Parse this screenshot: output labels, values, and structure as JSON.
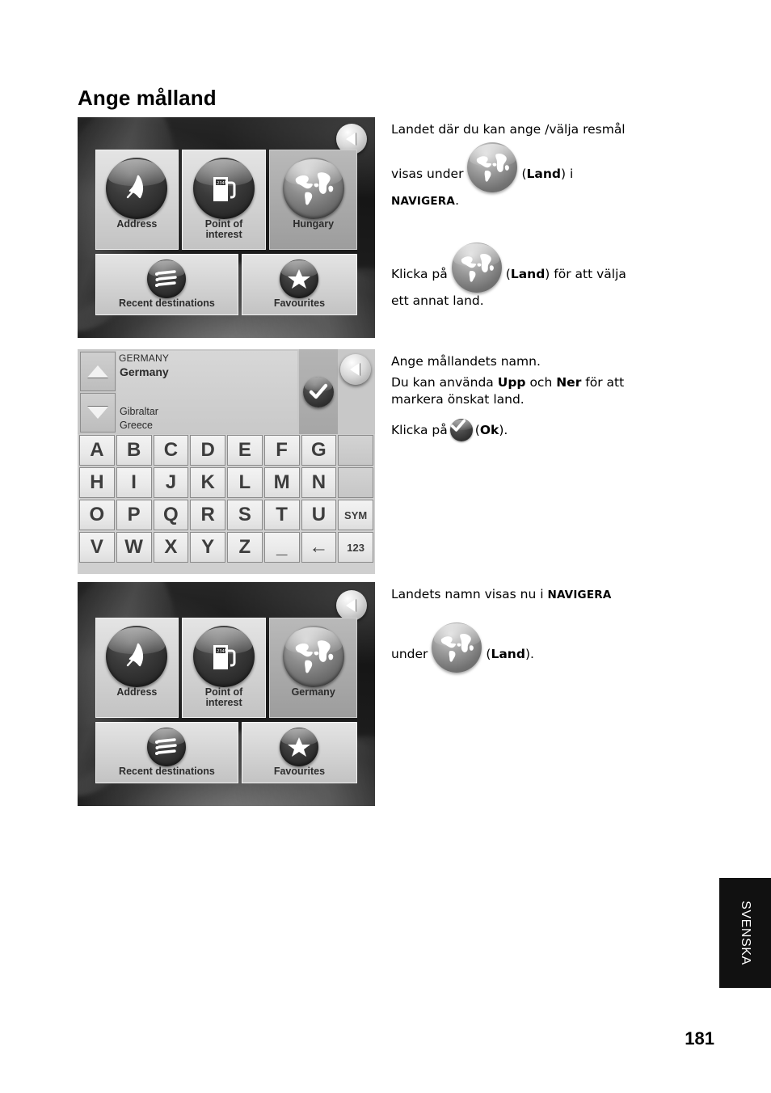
{
  "page": {
    "title": "Ange målland",
    "folio": "181",
    "language_tab": "SVENSKA"
  },
  "device_menu": {
    "tiles": [
      {
        "label": "Address",
        "icon": "map-pin-icon",
        "selected": false
      },
      {
        "label": "Point of interest",
        "label_line1": "Point of",
        "label_line2": "interest",
        "icon": "fuel-pump-icon",
        "selected": false
      },
      {
        "label": "Hungary",
        "icon": "globe-icon",
        "selected": true
      },
      {
        "label": "Recent destinations",
        "icon": "list-icon",
        "selected": false
      },
      {
        "label": "Favourites",
        "icon": "star-icon",
        "selected": false
      }
    ],
    "back_button": "back-arrow-icon"
  },
  "device_menu_after": {
    "tiles": [
      {
        "label": "Address",
        "icon": "map-pin-icon",
        "selected": false
      },
      {
        "label": "Point of interest",
        "label_line1": "Point of",
        "label_line2": "interest",
        "icon": "fuel-pump-icon",
        "selected": false
      },
      {
        "label": "Germany",
        "icon": "globe-icon",
        "selected": true
      },
      {
        "label": "Recent destinations",
        "icon": "list-icon",
        "selected": false
      },
      {
        "label": "Favourites",
        "icon": "star-icon",
        "selected": false
      }
    ],
    "back_button": "back-arrow-icon"
  },
  "device_keyboard": {
    "list": {
      "typed": "GERMANY",
      "highlighted": "Germany",
      "next_items": [
        "Gibraltar",
        "Greece"
      ]
    },
    "ok_button": "checkmark-icon",
    "up_button": "triangle-up-icon",
    "down_button": "triangle-down-icon",
    "back_button": "back-arrow-icon",
    "rows": [
      [
        "A",
        "B",
        "C",
        "D",
        "E",
        "F",
        "G",
        ""
      ],
      [
        "H",
        "I",
        "J",
        "K",
        "L",
        "M",
        "N",
        ""
      ],
      [
        "O",
        "P",
        "Q",
        "R",
        "S",
        "T",
        "U",
        "SYM"
      ],
      [
        "V",
        "W",
        "X",
        "Y",
        "Z",
        "_",
        "←",
        "123"
      ]
    ]
  },
  "text": {
    "block1": {
      "line1": "Landet där du kan ange /välja resmål",
      "before_icon": "visas under",
      "paren_open": "(",
      "bold": "Land",
      "paren_close": ") i",
      "smallcaps": "NAVIGERA",
      "period": "."
    },
    "block2": {
      "before_icon": "Klicka på",
      "paren_open": "(",
      "bold": "Land",
      "after": ") för att välja",
      "line2": "ett annat land."
    },
    "block3": {
      "line1": "Ange mållandets namn.",
      "line2a": "Du kan använda ",
      "bold1": "Upp",
      "line2b": " och ",
      "bold2": "Ner",
      "line2c": " för att",
      "line3": "markera önskat land.",
      "line4a": "Klicka på",
      "paren_open": "(",
      "bold3": "Ok",
      "paren_close": ")."
    },
    "block4": {
      "line1a": "Landets namn visas nu i ",
      "smallcaps": "NAVIGERA",
      "before_icon": "under",
      "paren_open": "(",
      "bold": "Land",
      "paren_close": ")."
    }
  }
}
